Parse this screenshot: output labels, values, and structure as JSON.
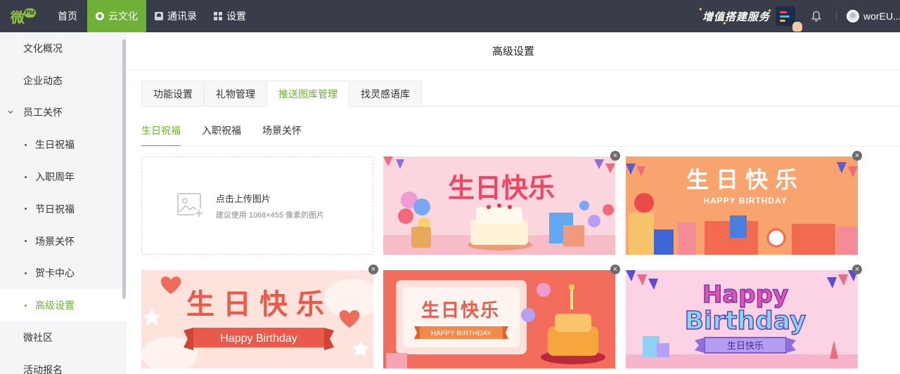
{
  "topbar": {
    "logo_text": "微",
    "logo_badge": "PM",
    "nav": [
      {
        "label": "首页",
        "icon": "home"
      },
      {
        "label": "云文化",
        "icon": "gear-icon"
      },
      {
        "label": "通讯录",
        "icon": "contacts-icon"
      },
      {
        "label": "设置",
        "icon": "grid-icon"
      }
    ],
    "promo_text": "增值搭建服务",
    "username": "worEU..."
  },
  "sidebar": {
    "items": [
      {
        "label": "文化概况"
      },
      {
        "label": "企业动态"
      },
      {
        "label": "员工关怀"
      },
      {
        "label": "生日祝福"
      },
      {
        "label": "入职周年"
      },
      {
        "label": "节日祝福"
      },
      {
        "label": "场景关怀"
      },
      {
        "label": "贺卡中心"
      },
      {
        "label": "高级设置"
      },
      {
        "label": "微社区"
      },
      {
        "label": "活动报名"
      }
    ]
  },
  "main": {
    "title": "高级设置",
    "tabs": [
      {
        "label": "功能设置"
      },
      {
        "label": "礼物管理"
      },
      {
        "label": "推送图库管理"
      },
      {
        "label": "找灵感语库"
      }
    ],
    "subtabs": [
      {
        "label": "生日祝福"
      },
      {
        "label": "入职祝福"
      },
      {
        "label": "场景关怀"
      }
    ],
    "upload": {
      "title": "点击上传图片",
      "hint": "建议使用 1068×455 像素的图片"
    },
    "cards": [
      {
        "title": "生日快乐"
      },
      {
        "title": "生日快乐",
        "subtitle": "HAPPY BIRTHDAY"
      },
      {
        "title": "生日快乐",
        "subtitle": "Happy Birthday"
      },
      {
        "title": "生日快乐",
        "subtitle": "HAPPY BIRTHDAY"
      },
      {
        "title": "Happy",
        "title2": "Birthday",
        "subtitle": "生日快乐"
      }
    ]
  },
  "colors": {
    "accent": "#6fb036",
    "topbar": "#393d49"
  }
}
